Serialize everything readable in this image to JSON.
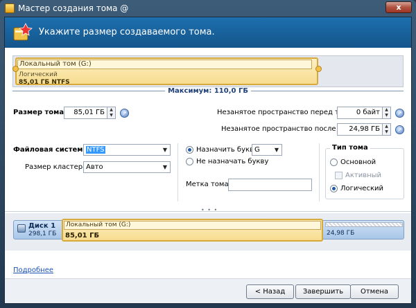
{
  "window": {
    "title": "Мастер создания тома @",
    "close_label": "x"
  },
  "header": {
    "title": "Укажите размер создаваемого тома."
  },
  "partition_bar": {
    "name": "Локальный том (G:)",
    "type": "Логический",
    "size_fs": "85,01 ГБ NTFS",
    "max_label": "Максимум: 110,0 ГБ"
  },
  "size": {
    "label": "Размер тома:",
    "value": "85,01 ГБ",
    "free_before_label": "Незанятое пространство перед томом:",
    "free_before_value": "0 байт",
    "free_after_label": "Незанятое пространство после тома:",
    "free_after_value": "24,98 ГБ"
  },
  "fs": {
    "label": "Файловая система:",
    "value": "NTFS",
    "cluster_label": "Размер кластера:",
    "cluster_value": "Авто"
  },
  "letter": {
    "assign_label": "Назначить букву:",
    "assign_value": "G",
    "none_label": "Не назначать букву",
    "volume_label": "Метка тома:",
    "volume_value": ""
  },
  "volume_type": {
    "title": "Тип тома",
    "primary": "Основной",
    "active": "Активный",
    "logical": "Логический"
  },
  "disk": {
    "name": "Диск 1",
    "capacity": "298,1 ГБ",
    "part_name": "Локальный том (G:)",
    "part_size": "85,01 ГБ",
    "unalloc_size": "24,98 ГБ"
  },
  "footer": {
    "more_link": "Подробнее",
    "back": "< Назад",
    "finish": "Завершить",
    "cancel": "Отмена"
  },
  "colors": {
    "header": "#1d6fae",
    "partition": "#f7dc8f",
    "disk": "#a9c6e8"
  }
}
